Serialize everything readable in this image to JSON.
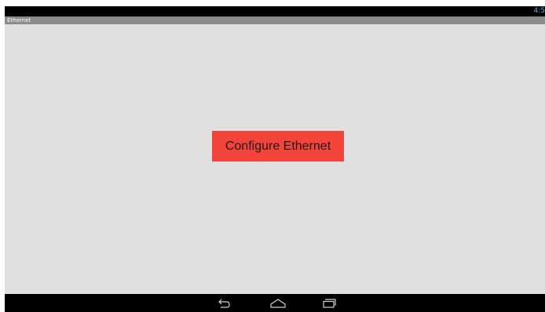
{
  "status_bar": {
    "time": "4:5"
  },
  "title_bar": {
    "title": "Ethernet"
  },
  "main": {
    "configure_button_label": "Configure Ethernet",
    "configure_button_color": "#f4443a",
    "background_color": "#e0e0e0"
  },
  "nav_bar": {
    "icons": [
      "back-icon",
      "home-icon",
      "recents-icon"
    ]
  }
}
